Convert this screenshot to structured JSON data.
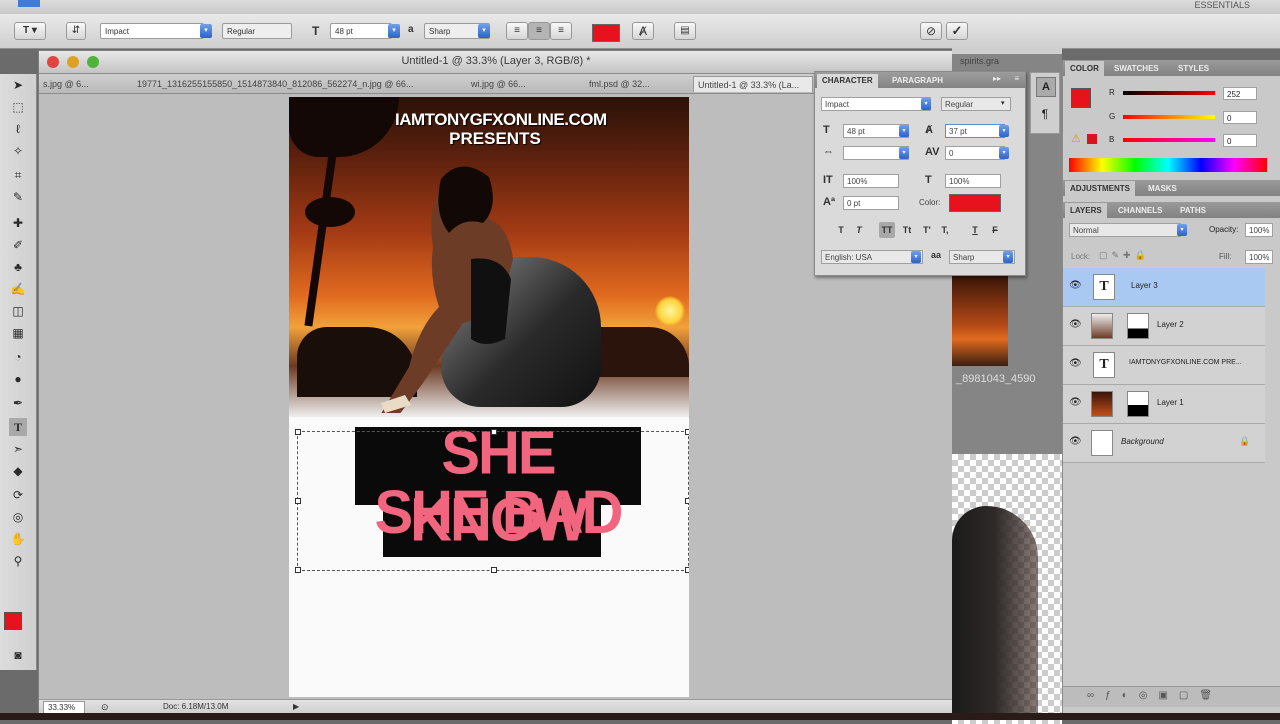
{
  "menubar": {
    "essentials": "ESSENTIALS"
  },
  "options_bar": {
    "font_family": "Impact",
    "font_style": "Regular",
    "font_size": "48 pt",
    "antialias": "Sharp",
    "text_color": "#e8121f",
    "cancel_icon": "cancel-icon",
    "commit_icon": "checkmark-icon"
  },
  "document": {
    "title": "Untitled-1 @ 33.3% (Layer 3, RGB/8) *",
    "tabs": [
      "s.jpg @ 6...",
      "19771_1316255155850_1514873840_812086_562274_n.jpg @ 66...",
      "wi.jpg @ 66...",
      "fml.psd @ 32...",
      "Untitled-1 @ 33.3% (La..."
    ],
    "zoom": "33.33%",
    "doc_size": "Doc: 6.18M/13.0M"
  },
  "poster": {
    "header_line1": "IAMTONYGFXONLINE.COM",
    "header_line2": "PRESENTS",
    "title_line1": "SHE KNOW",
    "title_line2": "SHE BAD"
  },
  "background_window": {
    "label": "_8981043_4590",
    "spirits": "spirits.gra"
  },
  "character_panel": {
    "tabs": [
      "CHARACTER",
      "PARAGRAPH"
    ],
    "font_family": "Impact",
    "font_style": "Regular",
    "size": "48 pt",
    "leading": "37 pt",
    "kerning": "",
    "tracking": "0",
    "vertical_scale": "100%",
    "horizontal_scale": "100%",
    "baseline_shift": "0 pt",
    "color_label": "Color:",
    "color": "#e8121f",
    "language": "English: USA",
    "antialias": "Sharp",
    "style_buttons": [
      "T",
      "T",
      "TT",
      "Tt",
      "T'",
      "T,",
      "T",
      "F"
    ]
  },
  "color_panel": {
    "tabs": [
      "COLOR",
      "SWATCHES",
      "STYLES"
    ],
    "channels": [
      {
        "label": "R",
        "value": "252"
      },
      {
        "label": "G",
        "value": "0"
      },
      {
        "label": "B",
        "value": "0"
      }
    ],
    "foreground": "#e8121f"
  },
  "adjustments_panel": {
    "tabs": [
      "ADJUSTMENTS",
      "MASKS"
    ]
  },
  "layers_panel": {
    "tabs": [
      "LAYERS",
      "CHANNELS",
      "PATHS"
    ],
    "blend_mode": "Normal",
    "opacity_label": "Opacity:",
    "opacity": "100%",
    "lock_label": "Lock:",
    "fill_label": "Fill:",
    "fill": "100%",
    "layers": [
      {
        "name": "Layer 3",
        "type": "text",
        "selected": true
      },
      {
        "name": "Layer 2",
        "type": "image-mask",
        "selected": false
      },
      {
        "name": "IAMTONYGFXONLINE.COM PRE...",
        "type": "text",
        "selected": false
      },
      {
        "name": "Layer 1",
        "type": "image-mask",
        "selected": false
      },
      {
        "name": "Background",
        "type": "background",
        "selected": false
      }
    ]
  }
}
